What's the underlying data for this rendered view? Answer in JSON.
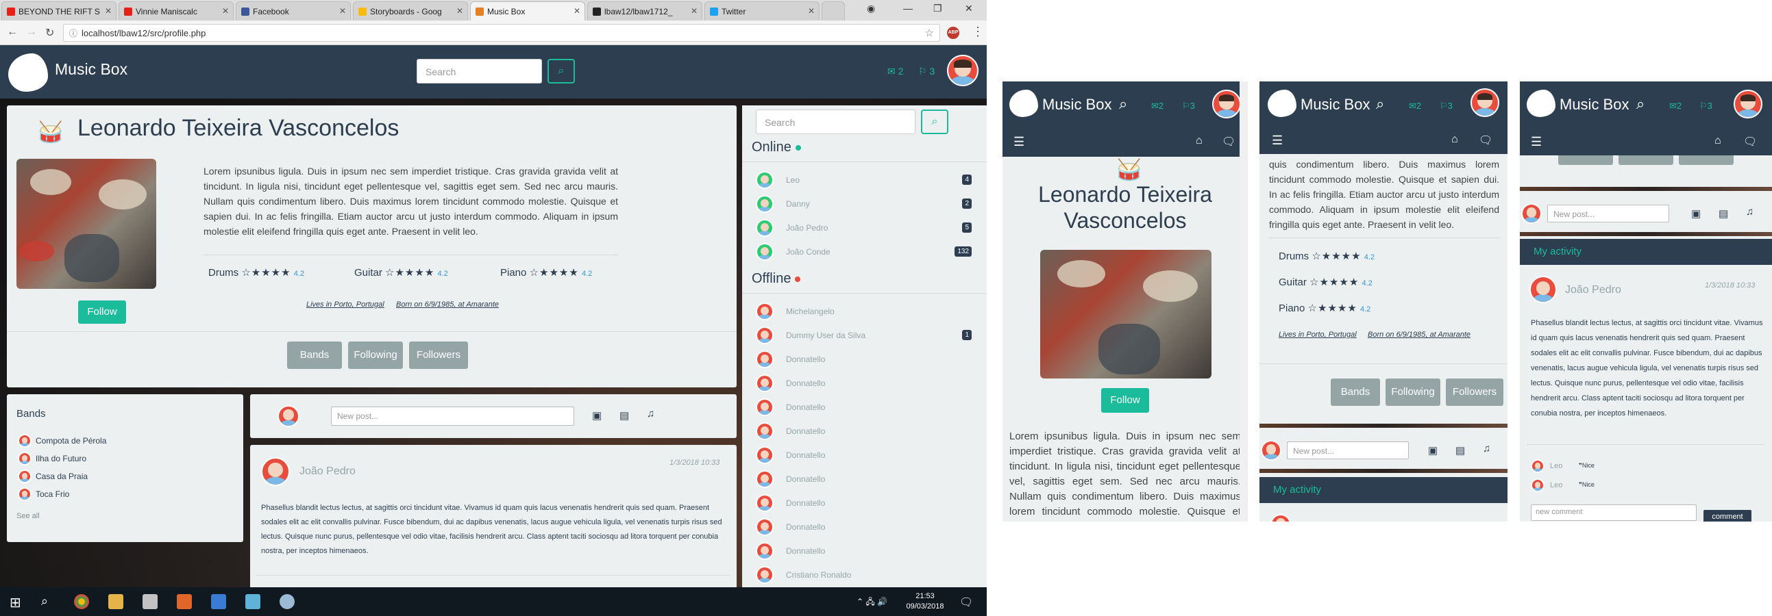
{
  "browser": {
    "tabs": [
      {
        "label": "BEYOND THE RIFT S",
        "color": "#e62117"
      },
      {
        "label": "Vinnie Maniscalc",
        "color": "#e62117"
      },
      {
        "label": "Facebook",
        "color": "#3b5998"
      },
      {
        "label": "Storyboards - Goog",
        "color": "#fbbc05"
      },
      {
        "label": "Music Box",
        "color": "#e67e22"
      },
      {
        "label": "lbaw12/lbaw1712_",
        "color": "#222222"
      },
      {
        "label": "Twitter",
        "color": "#1da1f2"
      }
    ],
    "url": "localhost/lbaw12/src/profile.php"
  },
  "site": {
    "brand": "Music Box",
    "search_placeholder": "Search",
    "messages_count": "2",
    "flags_count": "3"
  },
  "profile": {
    "name": "Leonardo Teixeira Vasconcelos",
    "bio": "Lorem ipsunibus ligula. Duis in ipsum nec sem imperdiet tristique. Cras gravida gravida velit at tincidunt. In ligula nisi, tincidunt eget pellentesque vel, sagittis eget sem. Sed nec arcu mauris. Nullam quis condimentum libero. Duis maximus lorem tincidunt commodo molestie. Quisque et sapien dui. In ac felis fringilla. Etiam auctor arcu ut justo interdum commodo. Aliquam in ipsum molestie elit eleifend fringilla quis eget ante. Praesent in velit leo.",
    "bio_mobile": "Lorem ipsunibus ligula. Duis in ipsum nec sem imperdiet tristique. Cras gravida gravida velit at tincidunt. In ligula nisi, tincidunt eget pellentesque vel, sagittis eget sem. Sed nec arcu mauris. Nullam quis condimentum libero. Duis maximus lorem tincidunt commodo molestie. Quisque et sapien dui.",
    "bio_mobile2": "quis condimentum libero. Duis maximus lorem tincidunt commodo molestie. Quisque et sapien dui. In ac felis fringilla. Etiam auctor arcu ut justo interdum commodo. Aliquam in ipsum molestie elit eleifend fringilla quis eget ante. Praesent in velit leo.",
    "skills": [
      {
        "name": "Drums",
        "rating": "4.2",
        "stars": 4.2
      },
      {
        "name": "Guitar",
        "rating": "4.2",
        "stars": 4.2
      },
      {
        "name": "Piano",
        "rating": "4.2",
        "stars": 4.2
      }
    ],
    "lives": "Lives in Porto, Portugal",
    "born": "Born on 6/9/1985, at Amarante",
    "follow_label": "Follow",
    "tabs": [
      "Bands",
      "Following",
      "Followers"
    ]
  },
  "bands": {
    "title": "Bands",
    "items": [
      "Compota de Pérola",
      "Ilha do Futuro",
      "Casa da Praia",
      "Toca Frio"
    ],
    "see_all": "See all"
  },
  "newpost": {
    "placeholder": "New post..."
  },
  "post": {
    "author": "João Pedro",
    "date": "1/3/2018 10:33",
    "body": "Phasellus blandit lectus lectus, at sagittis orci tincidunt vitae. Vivamus id quam quis lacus venenatis hendrerit quis sed quam. Praesent sodales elit ac elit convallis pulvinar. Fusce bibendum, dui ac dapibus venenatis, lacus augue vehicula ligula, vel venenatis turpis risus sed lectus. Quisque nunc purus, pellentesque vel odio vitae, facilisis hendrerit arcu. Class aptent taciti sociosqu ad litora torquent per conubia nostra, per inceptos himenaeos."
  },
  "sidebar": {
    "online_title": "Online",
    "offline_title": "Offline",
    "online": [
      {
        "name": "Leo",
        "badge": "4"
      },
      {
        "name": "Danny",
        "badge": "2"
      },
      {
        "name": "João Pedro",
        "badge": "5"
      },
      {
        "name": "João Conde",
        "badge": "132"
      }
    ],
    "offline": [
      {
        "name": "Michelangelo",
        "badge": ""
      },
      {
        "name": "Dummy User da Silva",
        "badge": "1"
      },
      {
        "name": "Donnatello",
        "badge": ""
      },
      {
        "name": "Donnatello",
        "badge": ""
      },
      {
        "name": "Donnatello",
        "badge": ""
      },
      {
        "name": "Donnatello",
        "badge": ""
      },
      {
        "name": "Donnatello",
        "badge": ""
      },
      {
        "name": "Donnatello",
        "badge": ""
      },
      {
        "name": "Donnatello",
        "badge": ""
      },
      {
        "name": "Donnatello",
        "badge": ""
      },
      {
        "name": "Donnatello",
        "badge": ""
      },
      {
        "name": "Cristiano Ronaldo",
        "badge": ""
      }
    ]
  },
  "mobile": {
    "activity_title": "My activity",
    "comments": [
      {
        "name": "Leo",
        "text": "Nice"
      },
      {
        "name": "Leo",
        "text": "Nice"
      }
    ],
    "comment_placeholder": "new comment",
    "comment_btn": "comment"
  },
  "taskbar": {
    "time": "21:53",
    "date": "09/03/2018"
  },
  "colors": {
    "nav": "#2c3e50",
    "accent": "#1abc9c",
    "card": "#ecf0f1",
    "grey_btn": "#95a5a6"
  }
}
